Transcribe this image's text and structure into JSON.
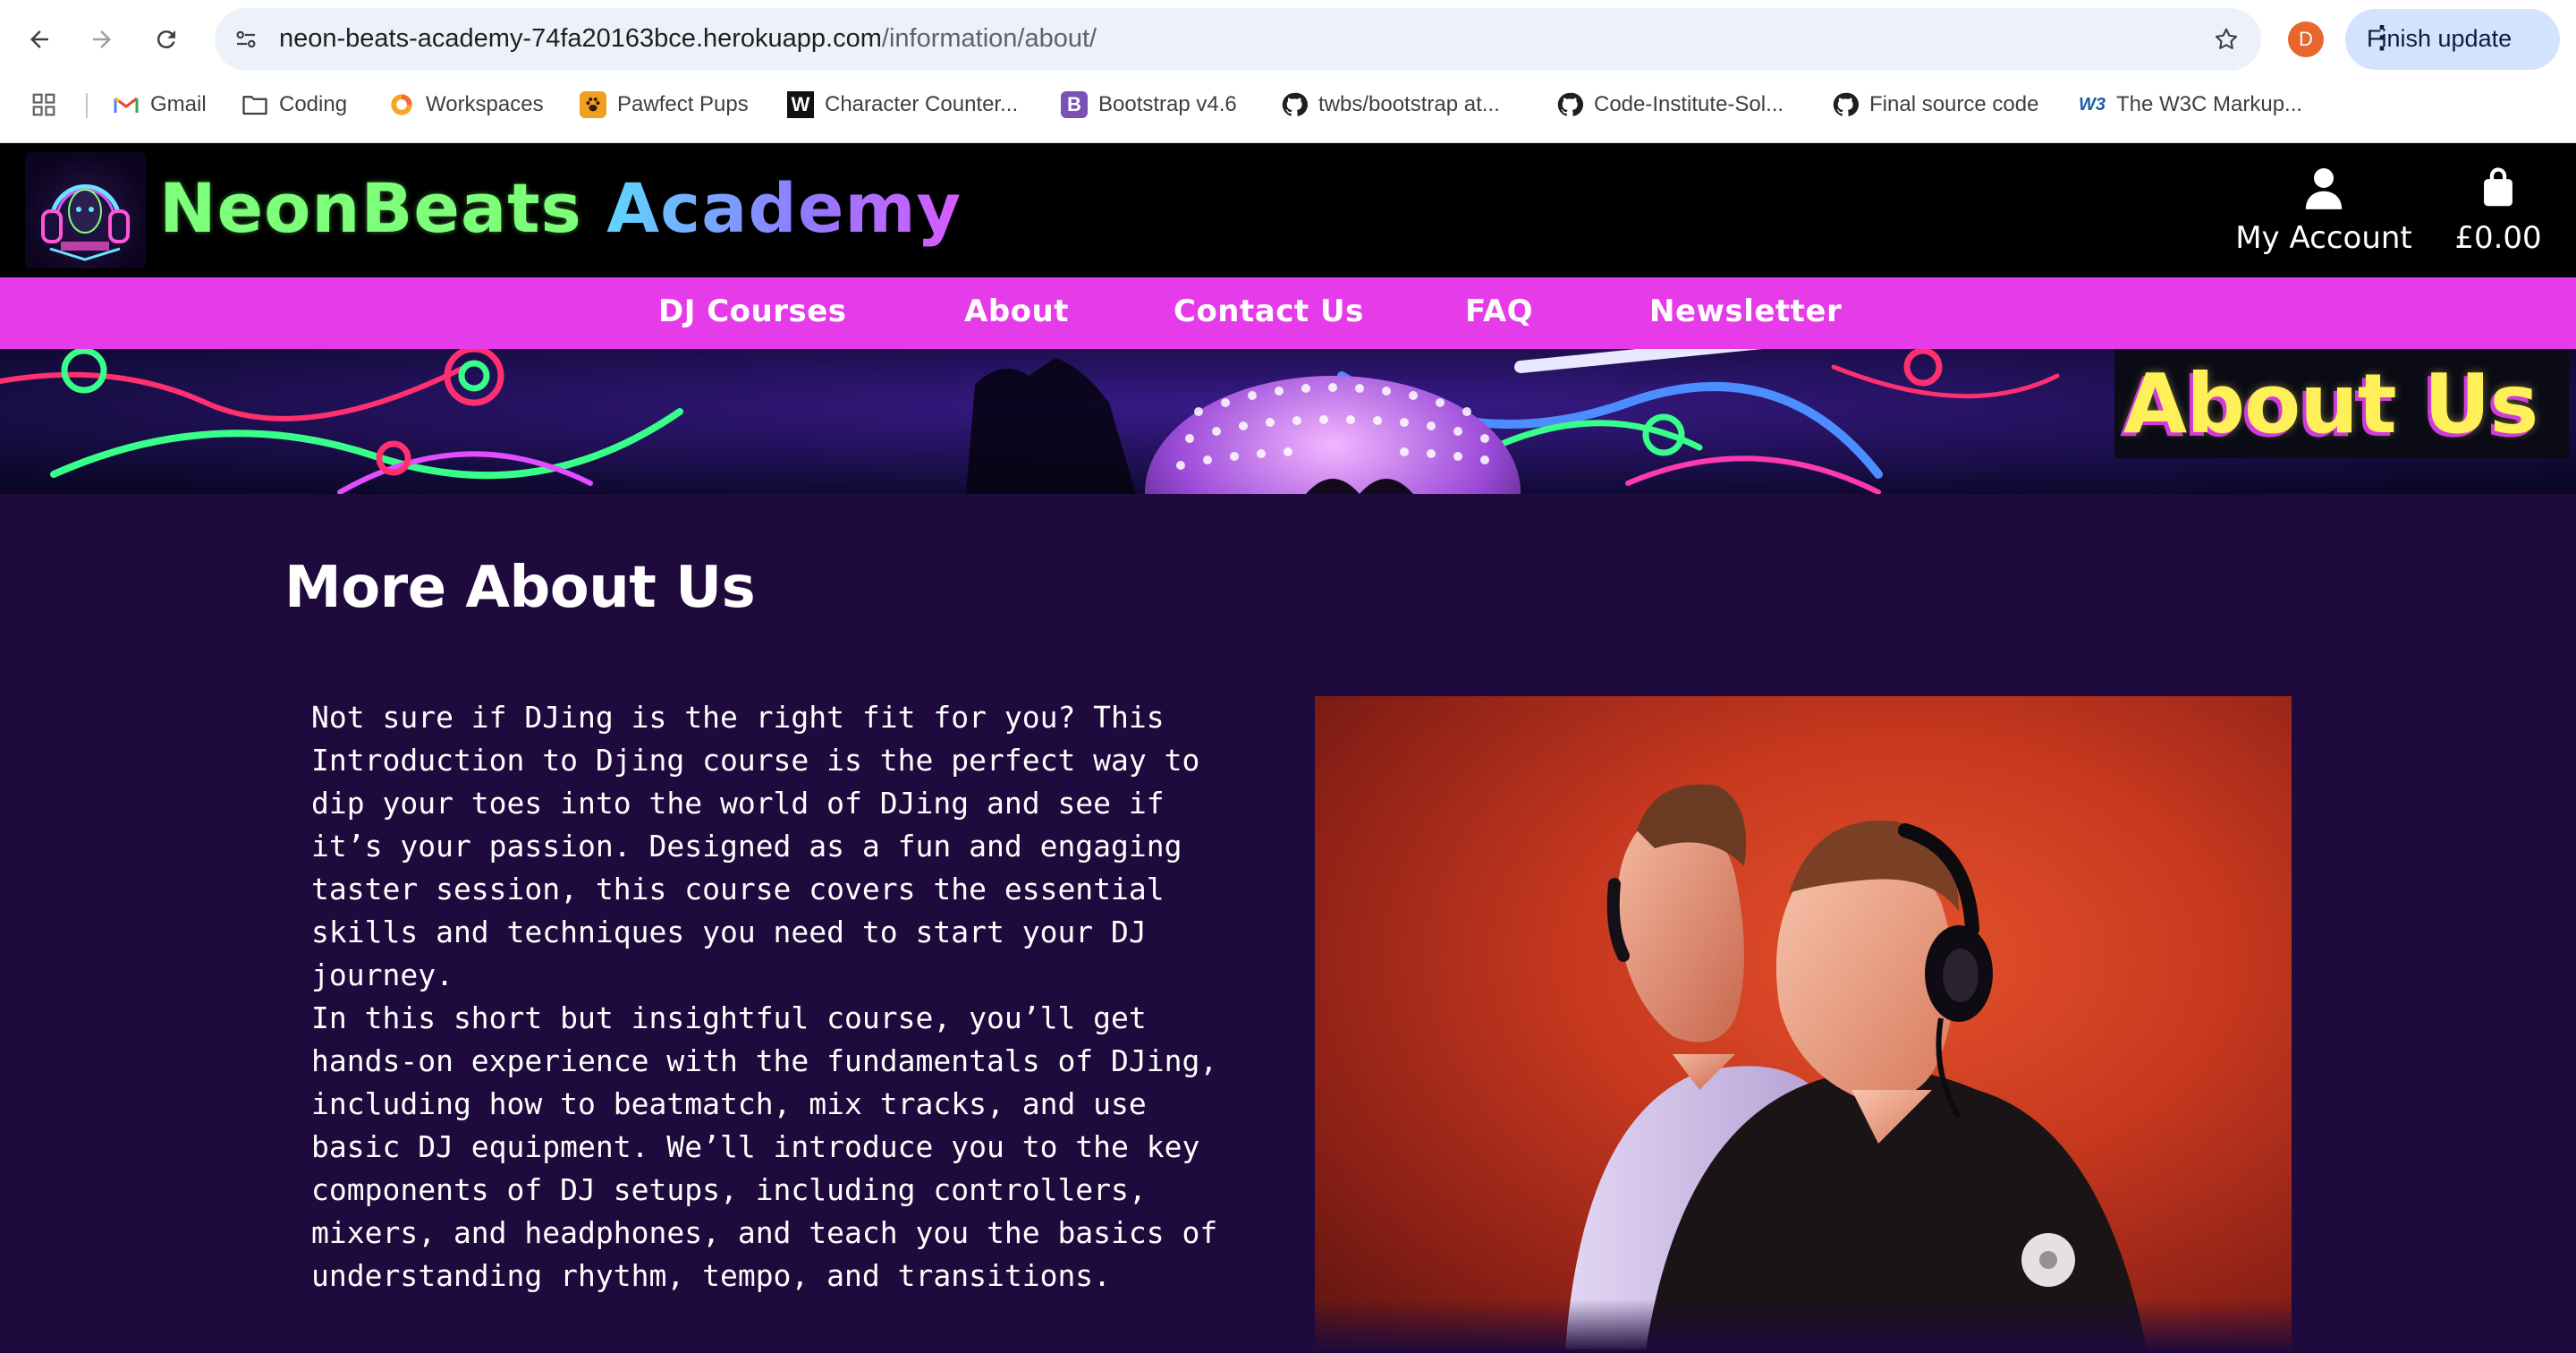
{
  "browser": {
    "url_host": "neon-beats-academy-74fa20163bce.herokuapp.com",
    "url_path": "/information/about/",
    "profile_initial": "D",
    "finish_update_label": "Finish update",
    "bookmarks": [
      {
        "label": "Gmail",
        "icon": "gmail-icon"
      },
      {
        "label": "Coding",
        "icon": "folder-icon"
      },
      {
        "label": "Workspaces",
        "icon": "workspaces-icon"
      },
      {
        "label": "Pawfect Pups",
        "icon": "paw-icon"
      },
      {
        "label": "Character Counter...",
        "icon": "w-icon"
      },
      {
        "label": "Bootstrap v4.6",
        "icon": "bootstrap-icon"
      },
      {
        "label": "twbs/bootstrap at...",
        "icon": "github-icon"
      },
      {
        "label": "Code-Institute-Sol...",
        "icon": "github-icon"
      },
      {
        "label": "Final source code",
        "icon": "github-icon"
      },
      {
        "label": "The W3C Markup...",
        "icon": "w3c-icon"
      }
    ]
  },
  "site": {
    "brand_part1": "NeonBeats",
    "brand_part2": "Academy",
    "account_label": "My Account",
    "cart_total": "£0.00",
    "nav": [
      "DJ Courses",
      "About",
      "Contact Us",
      "FAQ",
      "Newsletter"
    ],
    "hero_title": "About Us",
    "colors": {
      "nav_bg": "#e63be9",
      "page_bg": "#1e0a3c",
      "hero_title": "#fff05a",
      "brand_green": "#7dff7a"
    }
  },
  "main": {
    "heading": "More About Us",
    "paragraphs": [
      "Not sure if DJing is the right fit for you? This Introduction to Djing course is the perfect way to dip your toes into the world of DJing and see if it’s your passion. Designed as a fun and engaging taster session, this course covers the essential skills and techniques you need to start your DJ journey.",
      "In this short but insightful course, you’ll get hands-on experience with the fundamentals of DJing, including how to beatmatch, mix tracks, and use basic DJ equipment. We’ll introduce you to the key components of DJ setups, including controllers, mixers, and headphones, and teach you the basics of understanding rhythm, tempo, and transitions."
    ]
  }
}
